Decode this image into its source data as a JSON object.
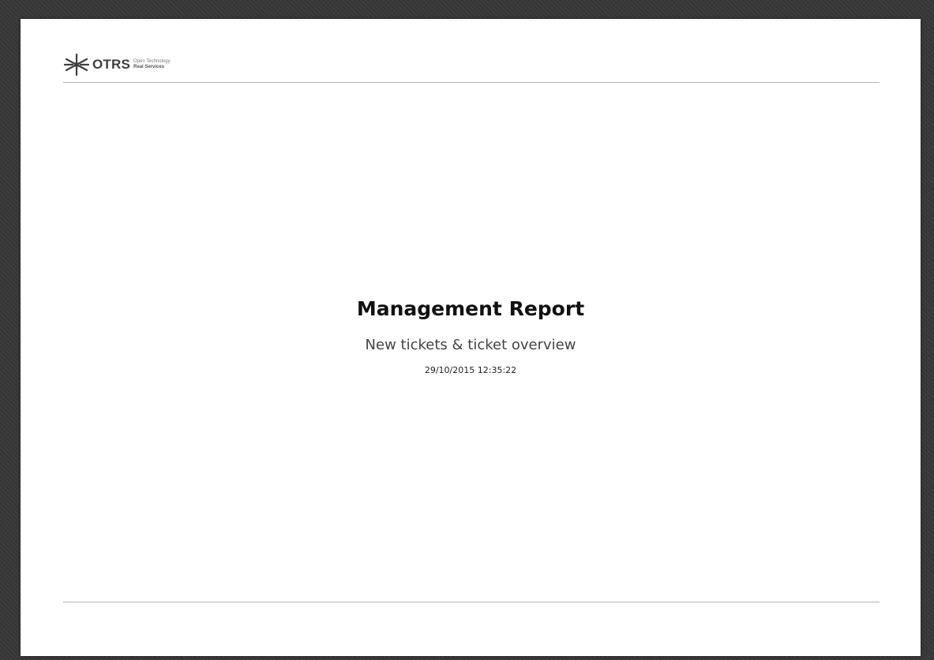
{
  "header": {
    "logo": {
      "brand": "OTRS",
      "tagline_line1": "Open Technology",
      "tagline_line2": "Real Services",
      "icon": "otrs-star-icon"
    }
  },
  "cover": {
    "title": "Management Report",
    "subtitle": "New tickets & ticket overview",
    "generated": "29/10/2015 12:35:22"
  },
  "colors": {
    "viewer_background": "#3a3a3a",
    "page": "#ffffff",
    "rule": "#b5b5b5",
    "logo_text": "#3f3f3f"
  }
}
